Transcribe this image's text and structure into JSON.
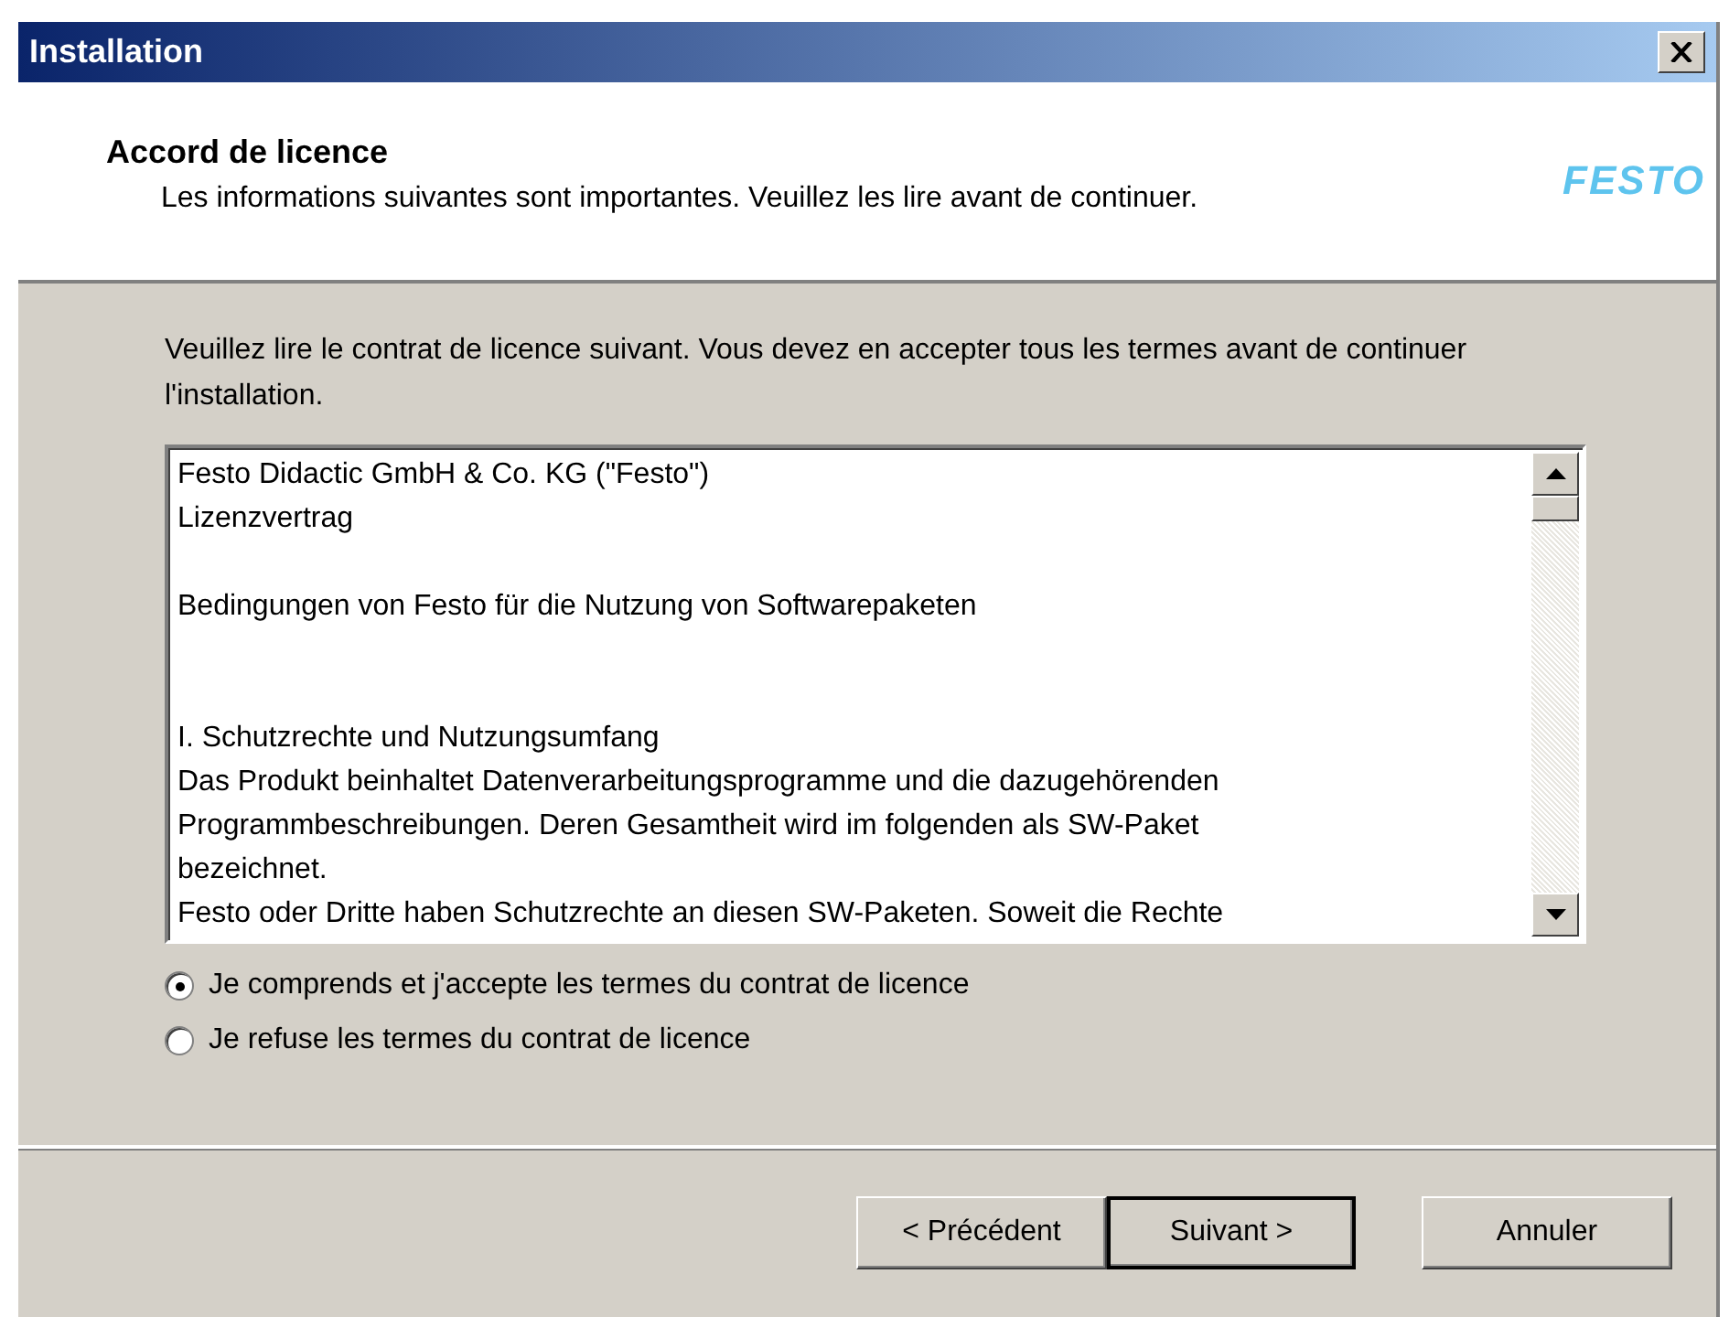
{
  "window": {
    "title": "Installation"
  },
  "header": {
    "title": "Accord de licence",
    "subtitle": "Les informations suivantes sont importantes. Veuillez les lire avant de continuer.",
    "logo": "FESTO"
  },
  "instruction": "Veuillez lire le contrat de licence suivant. Vous devez en accepter tous les termes avant de continuer l'installation.",
  "license_text": [
    {
      "kind": "intro",
      "lines": [
        "Festo Didactic GmbH  & Co. KG (\"Festo\")",
        "Lizenzvertrag"
      ]
    },
    {
      "kind": "heading",
      "lines": [
        "Bedingungen von Festo für die Nutzung von Softwarepaketen"
      ]
    },
    {
      "kind": "body",
      "lines": [
        "I. Schutzrechte und Nutzungsumfang",
        "Das Produkt beinhaltet Datenverarbeitungsprogramme und die dazugehörenden",
        "Programmbeschreibungen. Deren Gesamtheit wird im folgenden als SW-Paket",
        "bezeichnet.",
        "Festo oder Dritte haben Schutzrechte an diesen SW-Paketen. Soweit die Rechte"
      ]
    }
  ],
  "options": [
    {
      "label": "Je comprends et j'accepte les termes du contrat de licence",
      "selected": true
    },
    {
      "label": "Je refuse les termes du contrat de licence",
      "selected": false
    }
  ],
  "buttons": [
    {
      "label": "< Précédent",
      "default": false
    },
    {
      "label": "Suivant >",
      "default": true
    },
    {
      "label": "Annuler",
      "default": false
    }
  ]
}
